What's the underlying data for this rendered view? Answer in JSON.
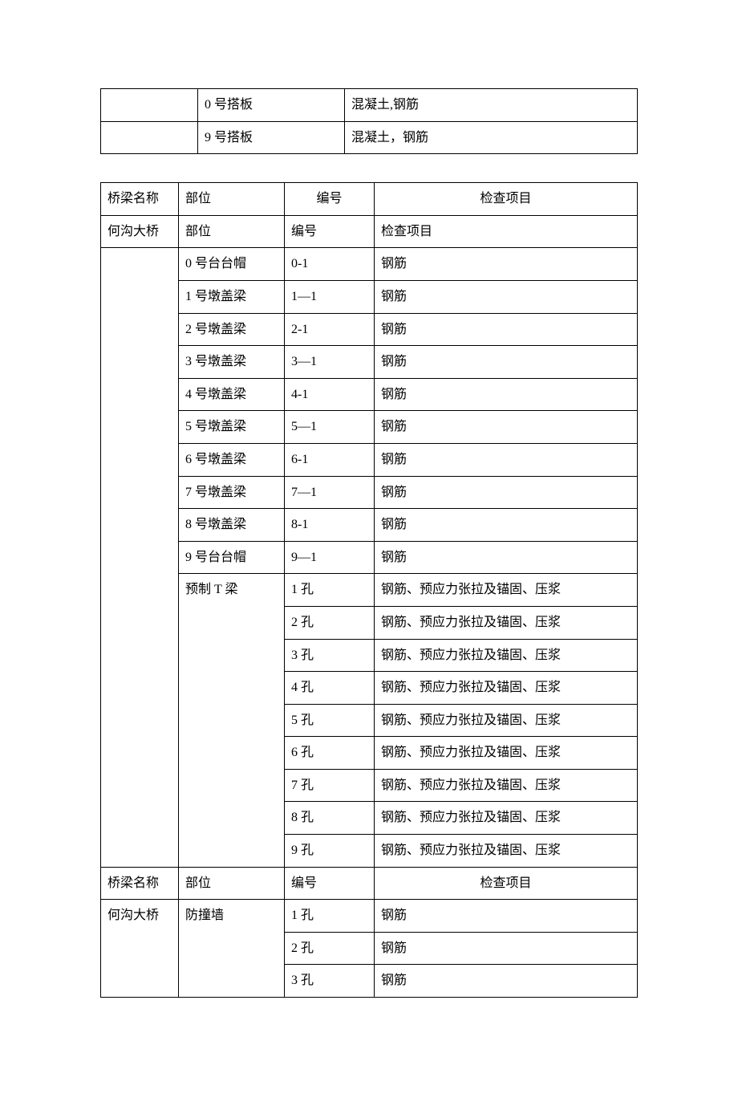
{
  "table1": {
    "rows": [
      {
        "c1": "",
        "c2": "0 号搭板",
        "c3": "混凝土,钢筋"
      },
      {
        "c1": "",
        "c2": "9 号搭板",
        "c3": "混凝土，钢筋"
      }
    ]
  },
  "table2": {
    "header1": {
      "c1": "桥梁名称",
      "c2": "部位",
      "c3": "编号",
      "c4": "检查项目"
    },
    "row1": {
      "c1": "何沟大桥",
      "c2": "部位",
      "c3": "编号",
      "c4": "检查项目"
    },
    "detailRows": [
      {
        "c2": "0 号台台帽",
        "c3": "0-1",
        "c4": "钢筋"
      },
      {
        "c2": "1 号墩盖梁",
        "c3": "1—1",
        "c4": "钢筋"
      },
      {
        "c2": "2 号墩盖梁",
        "c3": "2-1",
        "c4": "钢筋"
      },
      {
        "c2": "3 号墩盖梁",
        "c3": "3—1",
        "c4": "钢筋"
      },
      {
        "c2": "4 号墩盖梁",
        "c3": "4-1",
        "c4": "钢筋"
      },
      {
        "c2": "5 号墩盖梁",
        "c3": "5—1",
        "c4": "钢筋"
      },
      {
        "c2": "6 号墩盖梁",
        "c3": "6-1",
        "c4": "钢筋"
      },
      {
        "c2": "7 号墩盖梁",
        "c3": "7—1",
        "c4": "钢筋"
      },
      {
        "c2": "8 号墩盖梁",
        "c3": "8-1",
        "c4": "钢筋"
      },
      {
        "c2": "9 号台台帽",
        "c3": "9—1",
        "c4": "钢筋"
      }
    ],
    "beamSection": {
      "c2": "预制 T 梁",
      "rows": [
        {
          "c3": "1 孔",
          "c4": "钢筋、预应力张拉及锚固、压浆"
        },
        {
          "c3": "2 孔",
          "c4": "钢筋、预应力张拉及锚固、压浆"
        },
        {
          "c3": "3 孔",
          "c4": "钢筋、预应力张拉及锚固、压浆"
        },
        {
          "c3": "4 孔",
          "c4": "钢筋、预应力张拉及锚固、压浆"
        },
        {
          "c3": "5 孔",
          "c4": "钢筋、预应力张拉及锚固、压浆"
        },
        {
          "c3": "6 孔",
          "c4": "钢筋、预应力张拉及锚固、压浆"
        },
        {
          "c3": "7 孔",
          "c4": "钢筋、预应力张拉及锚固、压浆"
        },
        {
          "c3": "8 孔",
          "c4": "钢筋、预应力张拉及锚固、压浆"
        },
        {
          "c3": "9 孔",
          "c4": "钢筋、预应力张拉及锚固、压浆"
        }
      ]
    },
    "header2": {
      "c1": "桥梁名称",
      "c2": "部位",
      "c3": "编号",
      "c4": "检查项目"
    },
    "wallSection": {
      "c1": "何沟大桥",
      "c2": "防撞墙",
      "rows": [
        {
          "c3": "1 孔",
          "c4": "钢筋"
        },
        {
          "c3": "2 孔",
          "c4": "钢筋"
        },
        {
          "c3": "3 孔",
          "c4": "钢筋"
        }
      ]
    }
  }
}
